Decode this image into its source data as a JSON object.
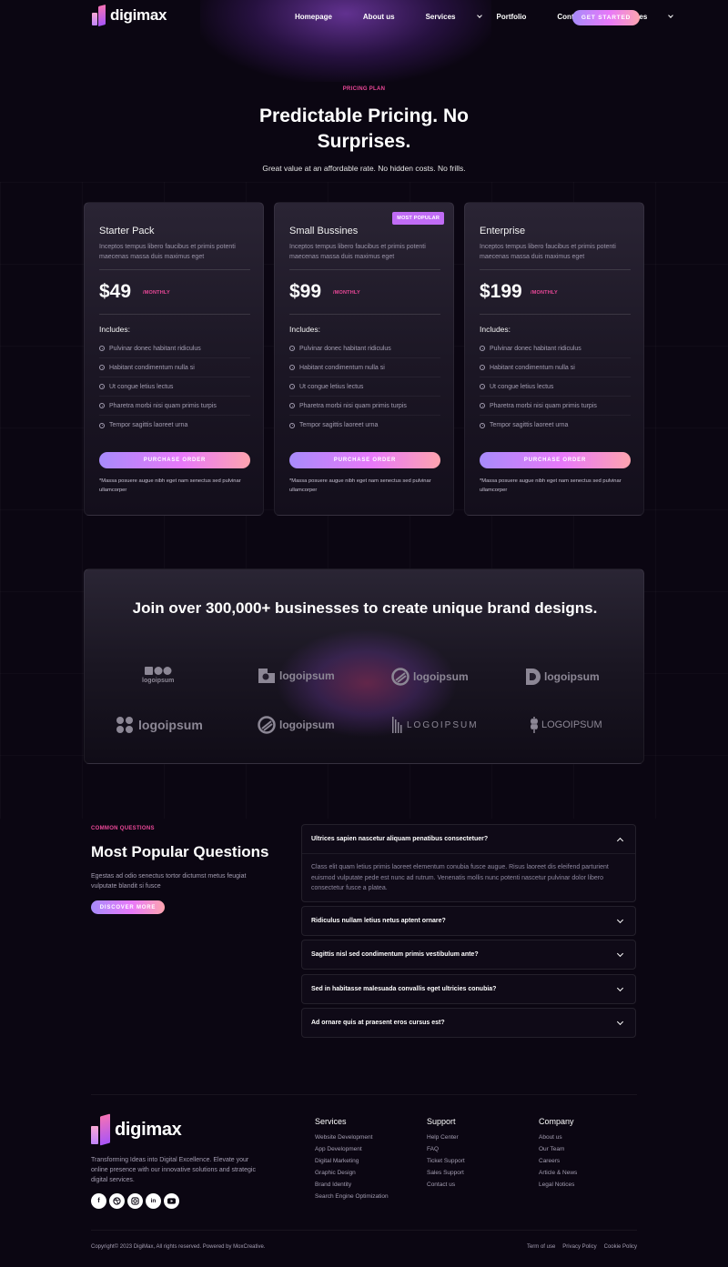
{
  "brand": {
    "name": "digimax"
  },
  "nav": {
    "items": [
      {
        "label": "Homepage",
        "dropdown": false
      },
      {
        "label": "About us",
        "dropdown": false
      },
      {
        "label": "Services",
        "dropdown": true
      },
      {
        "label": "Portfolio",
        "dropdown": false
      },
      {
        "label": "Contact us",
        "dropdown": false
      },
      {
        "label": "Pages",
        "dropdown": true
      }
    ],
    "cta": "GET STARTED"
  },
  "pricing": {
    "label": "PRICING PLAN",
    "title": "Predictable Pricing. No Surprises.",
    "subtitle": "Great value at an affordable rate. No hidden costs. No frills.",
    "period": "/MONTHLY",
    "includes_label": "Includes:",
    "button_label": "PURCHASE ORDER",
    "plans": [
      {
        "name": "Starter Pack",
        "description": "Inceptos tempus libero faucibus et primis potenti maecenas massa duis maximus eget",
        "price": "$49",
        "badge": "",
        "features": [
          "Pulvinar donec habitant ridiculus",
          "Habitant condimentum nulla si",
          "Ut congue letius lectus",
          "Pharetra morbi nisi quam primis turpis",
          "Tempor sagittis laoreet urna"
        ],
        "note": "*Massa posuere augue nibh eget nam senectus sed pulvinar ullamcorper"
      },
      {
        "name": "Small Bussines",
        "description": "Inceptos tempus libero faucibus et primis potenti maecenas massa duis maximus eget",
        "price": "$99",
        "badge": "MOST POPULAR",
        "features": [
          "Pulvinar donec habitant ridiculus",
          "Habitant condimentum nulla si",
          "Ut congue letius lectus",
          "Pharetra morbi nisi quam primis turpis",
          "Tempor sagittis laoreet urna"
        ],
        "note": "*Massa posuere augue nibh eget nam senectus sed pulvinar ullamcorper"
      },
      {
        "name": "Enterprise",
        "description": "Inceptos tempus libero faucibus et primis potenti maecenas massa duis maximus eget",
        "price": "$199",
        "badge": "",
        "features": [
          "Pulvinar donec habitant ridiculus",
          "Habitant condimentum nulla si",
          "Ut congue letius lectus",
          "Pharetra morbi nisi quam primis turpis",
          "Tempor sagittis laoreet urna"
        ],
        "note": "*Massa posuere augue nibh eget nam senectus sed pulvinar ullamcorper"
      }
    ]
  },
  "brands": {
    "title": "Join over 300,000+ businesses to create unique brand designs.",
    "logos": [
      "logoipsum",
      "logoipsum",
      "logoipsum",
      "logoipsum",
      "logoipsum",
      "logoipsum",
      "LOGOIPSUM",
      "LOGOIPSUM"
    ]
  },
  "faq": {
    "label": "COMMON QUESTIONS",
    "title": "Most Popular Questions",
    "description": "Egestas ad odio senectus tortor dictumst metus feugiat vulputate blandit si fusce",
    "button": "DISCOVER MORE",
    "items": [
      {
        "question": "Ultrices sapien nascetur aliquam penatibus consectetuer?",
        "answer": "Class elit quam letius primis laoreet elementum conubia fusce augue. Risus laoreet dis eleifend parturient euismod vulputate pede est nunc ad rutrum. Venenatis mollis nunc potenti nascetur pulvinar dolor libero consectetur fusce a platea.",
        "open": true
      },
      {
        "question": "Ridiculus nullam letius netus aptent ornare?",
        "answer": "",
        "open": false
      },
      {
        "question": "Sagittis nisl sed condimentum primis vestibulum ante?",
        "answer": "",
        "open": false
      },
      {
        "question": "Sed in habitasse malesuada convallis eget ultricies conubia?",
        "answer": "",
        "open": false
      },
      {
        "question": "Ad ornare quis at praesent eros cursus est?",
        "answer": "",
        "open": false
      }
    ]
  },
  "footer": {
    "description": "Transforming Ideas into Digital Excellence. Elevate your online presence with our innovative solutions and strategic digital services.",
    "socials": [
      "facebook-icon",
      "dribbble-icon",
      "instagram-icon",
      "linkedin-icon",
      "youtube-icon"
    ],
    "columns": [
      {
        "title": "Services",
        "links": [
          "Website Development",
          "App Development",
          "Digital Marketing",
          "Graphic Design",
          "Brand Identity",
          "Search Engine Optimization"
        ]
      },
      {
        "title": "Support",
        "links": [
          "Help Center",
          "FAQ",
          "Ticket Support",
          "Sales Support",
          "Contact us"
        ]
      },
      {
        "title": "Company",
        "links": [
          "About us",
          "Our Team",
          "Careers",
          "Article & News",
          "Legal Notices"
        ]
      }
    ],
    "copyright": "Copyright© 2023 DigiMax, All rights reserved. Powered by MoxCreative.",
    "legal": [
      "Term of use",
      "Privacy Policy",
      "Cookie Policy"
    ]
  }
}
